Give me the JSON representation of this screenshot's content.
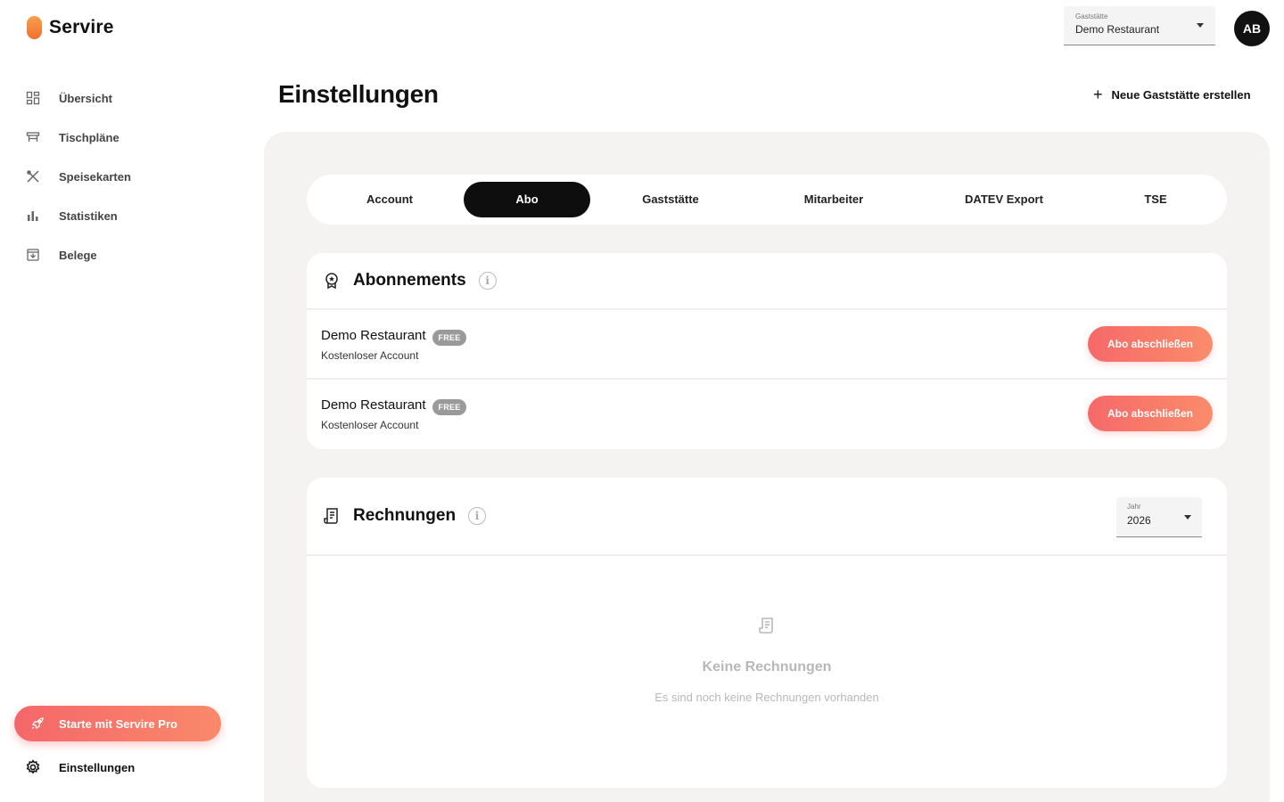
{
  "app": {
    "name": "Servire"
  },
  "sidebar": {
    "items": [
      {
        "label": "Übersicht",
        "icon": "dashboard-icon"
      },
      {
        "label": "Tischpläne",
        "icon": "table-icon"
      },
      {
        "label": "Speisekarten",
        "icon": "cutlery-icon"
      },
      {
        "label": "Statistiken",
        "icon": "bar-chart-icon"
      },
      {
        "label": "Belege",
        "icon": "archive-icon"
      }
    ],
    "pro_button": "Starte mit Servire Pro",
    "settings": "Einstellungen"
  },
  "header": {
    "restaurant_select": {
      "label": "Gaststätte",
      "value": "Demo Restaurant"
    },
    "avatar_initials": "AB"
  },
  "page": {
    "title": "Einstellungen",
    "new_restaurant": "Neue Gaststätte erstellen"
  },
  "tabs": [
    {
      "label": "Account",
      "active": false
    },
    {
      "label": "Abo",
      "active": true
    },
    {
      "label": "Gaststätte",
      "active": false
    },
    {
      "label": "Mitarbeiter",
      "active": false
    },
    {
      "label": "DATEV Export",
      "active": false
    },
    {
      "label": "TSE",
      "active": false
    }
  ],
  "subscriptions": {
    "title": "Abonnements",
    "info": "i",
    "rows": [
      {
        "name": "Demo Restaurant",
        "badge": "FREE",
        "sub": "Kostenloser Account",
        "button": "Abo abschließen"
      },
      {
        "name": "Demo Restaurant",
        "badge": "FREE",
        "sub": "Kostenloser Account",
        "button": "Abo abschließen"
      }
    ]
  },
  "invoices": {
    "title": "Rechnungen",
    "info": "i",
    "year_select": {
      "label": "Jahr",
      "value": "2026"
    },
    "empty_title": "Keine Rechnungen",
    "empty_text": "Es sind noch keine Rechnungen vorhanden"
  },
  "colors": {
    "accent": "#f6696a",
    "accent_end": "#fa8c6a",
    "dark": "#0e0e0e",
    "panel": "#f4f3f2"
  }
}
